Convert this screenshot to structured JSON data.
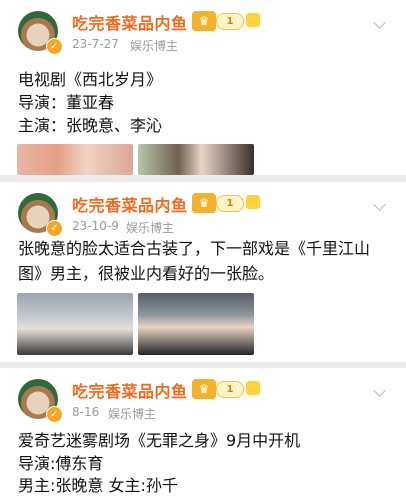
{
  "posts": [
    {
      "author": "吃完香菜品内鱼",
      "level": "1",
      "date": "23-7-27",
      "role": "娱乐博主",
      "lines": [
        "电视剧《西北岁月》",
        "导演：董亚春",
        "主演：张晚意、李沁"
      ]
    },
    {
      "author": "吃完香菜品内鱼",
      "level": "1",
      "date": "23-10-9",
      "role": "娱乐博主",
      "lines": [
        "张晚意的脸太适合古装了，下一部戏是《千里江山",
        "图》男主，很被业内看好的一张脸。"
      ]
    },
    {
      "author": "吃完香菜品内鱼",
      "level": "1",
      "date": "8-16",
      "role": "娱乐博主",
      "lines": [
        "爱奇艺迷雾剧场《无罪之身》9月中开机",
        "导演:傅东育",
        "男主:张晚意  女主:孙千"
      ]
    }
  ],
  "icons": {
    "verified": "verified-badge-icon",
    "member": "crown-icon",
    "menu": "chevron-down-icon"
  },
  "colors": {
    "author": "#ef6a1a",
    "meta": "#9a9a9a",
    "text": "#111111",
    "page_bg": "#ececec"
  }
}
